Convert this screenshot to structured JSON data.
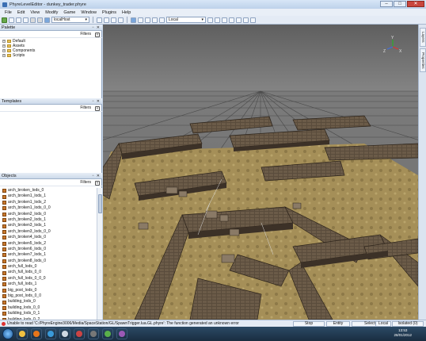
{
  "window": {
    "title": "PhyreLevelEditor - dunkey_trader.phyre"
  },
  "menu": [
    "File",
    "Edit",
    "View",
    "Modify",
    "Game",
    "Window",
    "Plugins",
    "Help"
  ],
  "toolbar": {
    "host": "localHost",
    "space": "Local"
  },
  "palette": {
    "title": "Palette",
    "filter": "Filters",
    "items": [
      "Default",
      "Assets",
      "Components",
      "Scripts"
    ]
  },
  "templates": {
    "title": "Templates",
    "filter": "Filters"
  },
  "objects": {
    "title": "Objects",
    "filter": "Filters",
    "items": [
      "arch_broken_lods_0",
      "arch_broken1_lods_1",
      "arch_broken1_lods_2",
      "arch_broken1_lods_0_0",
      "arch_broken2_lods_0",
      "arch_broken2_lods_1",
      "arch_broken3_lods_1",
      "arch_broken3_lods_0_0",
      "arch_broken4_lods_0",
      "arch_broken5_lods_2",
      "arch_broken6_lods_0",
      "arch_broken7_lods_1",
      "arch_broken8_lods_0",
      "arch_full_lods_0",
      "arch_full_lods_0_0",
      "arch_full_lods_0_0_0",
      "arch_full_lods_1",
      "big_post_lods_0",
      "big_post_lods_0_0",
      "building_lods_0",
      "building_lods_0_0",
      "building_lods_0_1",
      "building_lods_0_2"
    ]
  },
  "sidebar_tabs": [
    "Layers",
    "Properties"
  ],
  "gizmo": {
    "x": "X",
    "y": "Y",
    "z": "Z"
  },
  "status": {
    "message": "Unable to read 'C:/PhyreEngine3006/Media/SpaceStation/GL/SpawnTrigger.lua.GL.phyre': The function generated an unknown error",
    "buttons": [
      "Stop",
      "Entity",
      "Select",
      "Local",
      "Isolated (0)"
    ]
  },
  "clock": {
    "time": "13:53",
    "date": "28/01/2012"
  }
}
